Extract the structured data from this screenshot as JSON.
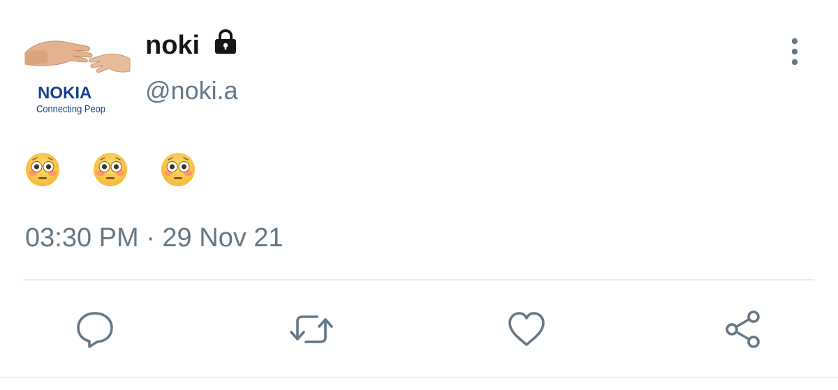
{
  "user": {
    "display_name": "noki",
    "handle": "@noki.a",
    "protected_icon": "lock-icon",
    "avatar": {
      "logo_text": "NOKIA",
      "slogan_text": "Connecting People",
      "brand_color": "#124191"
    }
  },
  "tweet": {
    "text_emojis": [
      "😳",
      "😳",
      "😳"
    ],
    "timestamp": "03:30 PM · 29 Nov 21"
  },
  "actions": [
    {
      "name": "reply",
      "icon": "comment-icon"
    },
    {
      "name": "retweet",
      "icon": "retweet-icon"
    },
    {
      "name": "like",
      "icon": "heart-icon"
    },
    {
      "name": "share",
      "icon": "share-icon"
    }
  ],
  "menu": {
    "icon": "more-vertical-icon"
  },
  "colors": {
    "text_primary": "#14171a",
    "text_secondary": "#657786",
    "icon": "#657786",
    "divider": "#e6ecf0"
  }
}
